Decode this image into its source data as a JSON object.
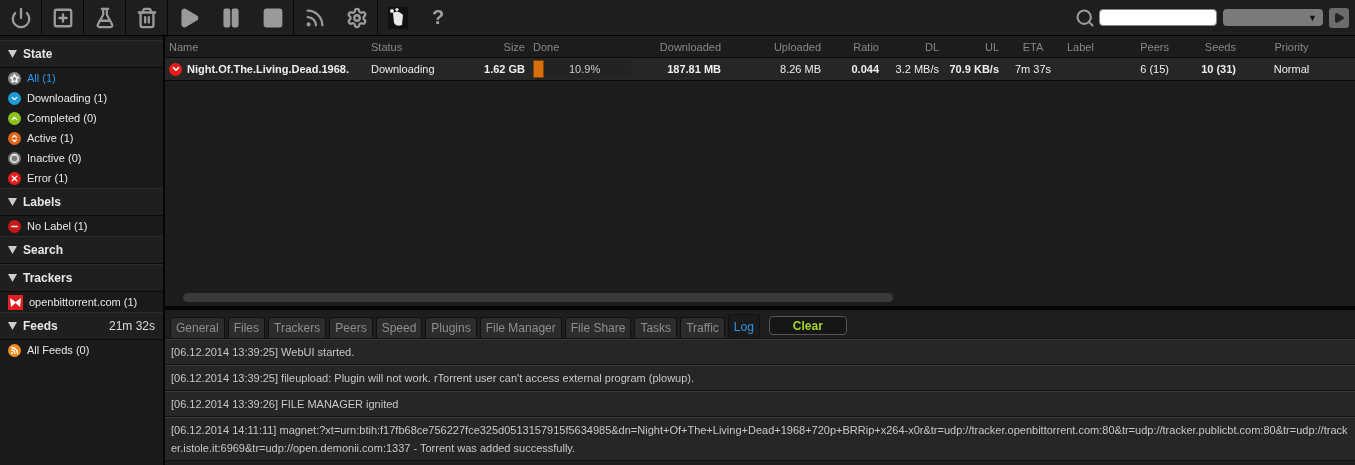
{
  "toolbar": {
    "buttons": [
      {
        "kind": "power"
      },
      {
        "kind": "add"
      },
      {
        "kind": "flask"
      },
      {
        "kind": "trash"
      },
      {
        "kind": "play"
      },
      {
        "kind": "pause"
      },
      {
        "kind": "stop"
      },
      {
        "kind": "rss"
      },
      {
        "kind": "settings"
      },
      {
        "kind": "logo"
      }
    ],
    "help": "?",
    "search": {
      "select_caret": "▼"
    }
  },
  "sidebar": {
    "sections": [
      {
        "title": "State",
        "items": [
          {
            "label": "All (1)",
            "selected": true,
            "kind": "star",
            "color": "#8a8a8a"
          },
          {
            "label": "Downloading (1)",
            "selected": false,
            "kind": "down",
            "color": "#1e9ad8"
          },
          {
            "label": "Completed (0)",
            "selected": false,
            "kind": "up",
            "color": "#8cc21c"
          },
          {
            "label": "Active (1)",
            "selected": false,
            "kind": "updown",
            "color": "#e0661c"
          },
          {
            "label": "Inactive (0)",
            "selected": false,
            "kind": "dot",
            "color": "#7a7a7a"
          },
          {
            "label": "Error (1)",
            "selected": false,
            "kind": "x",
            "color": "#e81c1c"
          }
        ]
      },
      {
        "title": "Labels",
        "items": [
          {
            "label": "No Label (1)",
            "selected": false,
            "kind": "minus",
            "color": "#c81818"
          }
        ]
      },
      {
        "title": "Search"
      },
      {
        "title": "Trackers",
        "items": [
          {
            "label": "openbittorrent.com (1)",
            "selected": false,
            "kind": "favicon",
            "color": "#e02020"
          }
        ]
      },
      {
        "title": "Feeds",
        "timer": "21m 32s",
        "items": [
          {
            "label": "All Feeds (0)",
            "selected": false,
            "kind": "rss",
            "color": "#f08a1c"
          }
        ]
      }
    ]
  },
  "table": {
    "columns": [
      {
        "label": "Name"
      },
      {
        "label": "Status"
      },
      {
        "label": "Size"
      },
      {
        "label": "Done"
      },
      {
        "label": "Downloaded"
      },
      {
        "label": "Uploaded"
      },
      {
        "label": "Ratio"
      },
      {
        "label": "DL"
      },
      {
        "label": "UL"
      },
      {
        "label": "ETA"
      },
      {
        "label": "Label"
      },
      {
        "label": "Peers"
      },
      {
        "label": "Seeds"
      },
      {
        "label": "Priority"
      }
    ],
    "rows": [
      {
        "selected": false,
        "level": 0.109,
        "cells": [
          "Night.Of.The.Living.Dead.1968.",
          "Downloading",
          "1.62 GB",
          "10.9%",
          "187.81 MB",
          "8.26 MB",
          "0.044",
          "3.2 MB/s",
          "70.9 KB/s",
          "7m 37s",
          "",
          "6 (15)",
          "10 (31)",
          "Normal"
        ]
      }
    ]
  },
  "details": {
    "tabs": [
      {
        "label": "General",
        "selected": false
      },
      {
        "label": "Files",
        "selected": false
      },
      {
        "label": "Trackers",
        "selected": false
      },
      {
        "label": "Peers",
        "selected": false
      },
      {
        "label": "Speed",
        "selected": false
      },
      {
        "label": "Plugins",
        "selected": false
      },
      {
        "label": "File Manager",
        "selected": false
      },
      {
        "label": "File Share",
        "selected": false
      },
      {
        "label": "Tasks",
        "selected": false
      },
      {
        "label": "Traffic",
        "selected": false
      },
      {
        "label": "Log",
        "selected": true
      }
    ],
    "clear_button": "Clear",
    "log": [
      "[06.12.2014 13:39:25] WebUI started.",
      "[06.12.2014 13:39:25] fileupload: Plugin will not work. rTorrent user can't access external program (plowup).",
      "[06.12.2014 13:39:26] FILE MANAGER ignited",
      "[06.12.2014 14:11:11] magnet:?xt=urn:btih:f17fb68ce756227fce325d0513157915f5634985&dn=Night+Of+The+Living+Dead+1968+720p+BRRip+x264-x0r&tr=udp://tracker.openbittorrent.com:80&tr=udp://tracker.publicbt.com:80&tr=udp://tracker.istole.it:6969&tr=udp://open.demonii.com:1337 - Torrent was added successfully."
    ]
  }
}
